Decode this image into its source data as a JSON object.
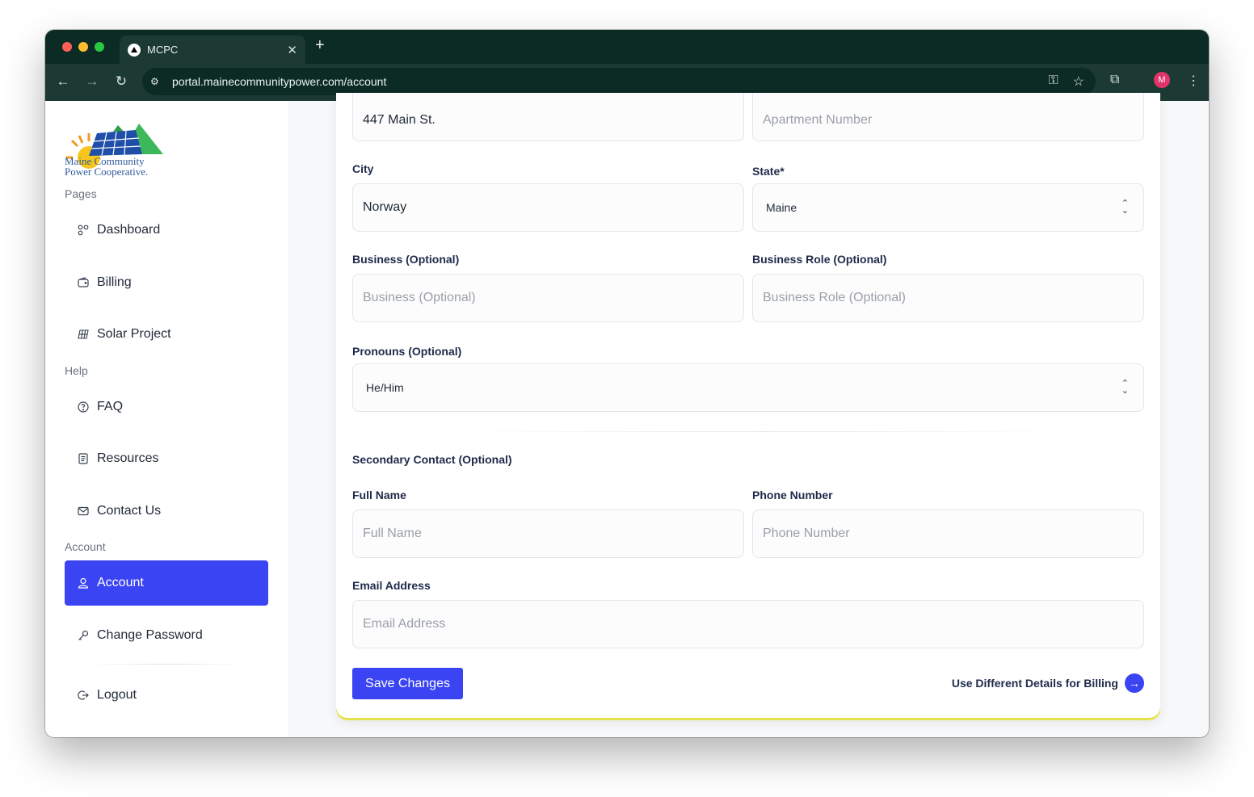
{
  "browser": {
    "tab_title": "MCPC",
    "url": "portal.mainecommunitypower.com/account",
    "avatar_initial": "M"
  },
  "brand": {
    "line1": "Maine Community",
    "line2": "Power Cooperative."
  },
  "sidebar": {
    "pages_label": "Pages",
    "help_label": "Help",
    "account_label": "Account",
    "items": [
      {
        "label": "Dashboard",
        "icon": "dashboard-icon"
      },
      {
        "label": "Billing",
        "icon": "wallet-icon"
      },
      {
        "label": "Solar Project",
        "icon": "solar-panel-icon"
      },
      {
        "label": "FAQ",
        "icon": "question-icon"
      },
      {
        "label": "Resources",
        "icon": "document-icon"
      },
      {
        "label": "Contact Us",
        "icon": "mail-icon"
      },
      {
        "label": "Account",
        "icon": "user-icon",
        "active": true
      },
      {
        "label": "Change Password",
        "icon": "key-icon"
      },
      {
        "label": "Logout",
        "icon": "logout-icon"
      }
    ]
  },
  "form": {
    "address": {
      "value": "447 Main St."
    },
    "apartment": {
      "placeholder": "Apartment Number"
    },
    "city": {
      "label": "City",
      "value": "Norway"
    },
    "state": {
      "label": "State*",
      "value": "Maine"
    },
    "business": {
      "label": "Business (Optional)",
      "placeholder": "Business (Optional)"
    },
    "business_role": {
      "label": "Business Role (Optional)",
      "placeholder": "Business Role (Optional)"
    },
    "pronouns": {
      "label": "Pronouns (Optional)",
      "value": "He/Him"
    },
    "secondary_title": "Secondary Contact (Optional)",
    "full_name": {
      "label": "Full Name",
      "placeholder": "Full Name"
    },
    "phone": {
      "label": "Phone Number",
      "placeholder": "Phone Number"
    },
    "email": {
      "label": "Email Address",
      "placeholder": "Email Address"
    },
    "save_label": "Save Changes",
    "billing_link": "Use Different Details for Billing"
  },
  "colors": {
    "accent": "#3a44f2",
    "browser_chrome": "#0c2b24",
    "card_underline": "#e6e24f"
  }
}
